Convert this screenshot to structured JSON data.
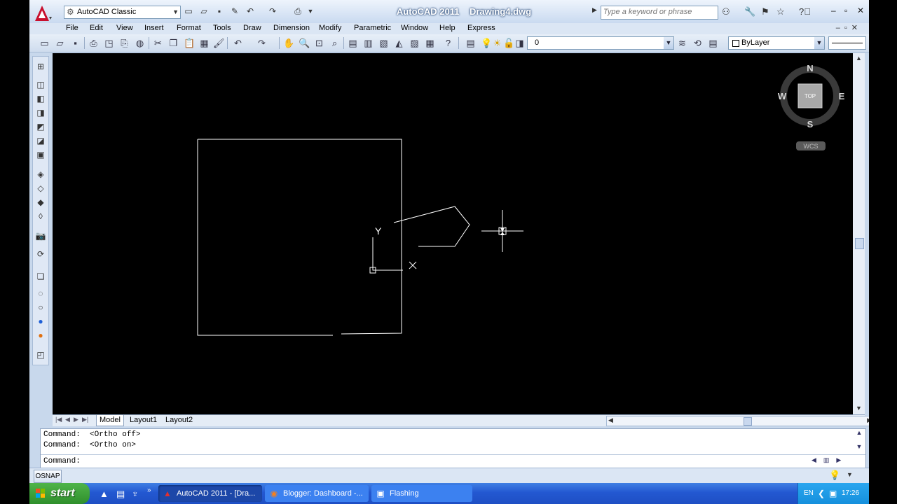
{
  "window": {
    "title": "AutoCAD 2011    Drawing4.dwg",
    "workspace": "AutoCAD Classic"
  },
  "search": {
    "placeholder": "Type a keyword or phrase"
  },
  "menu": [
    "File",
    "Edit",
    "View",
    "Insert",
    "Format",
    "Tools",
    "Draw",
    "Dimension",
    "Modify",
    "Parametric",
    "Window",
    "Help",
    "Express"
  ],
  "layer": {
    "current": "0"
  },
  "color": {
    "current": "ByLayer"
  },
  "viewcube": {
    "n": "N",
    "s": "S",
    "e": "E",
    "w": "W",
    "face": "TOP",
    "wcs": "WCS"
  },
  "ucs": {
    "x": "X",
    "y": "Y"
  },
  "tabs": {
    "model": "Model",
    "layout1": "Layout1",
    "layout2": "Layout2"
  },
  "command": {
    "history": [
      "Command:  <Ortho off>",
      "Command:  <Ortho on>"
    ],
    "prompt": "Command:"
  },
  "status": {
    "osnap": "OSNAP"
  },
  "taskbar": {
    "start": "start",
    "tasks": [
      "AutoCAD 2011 - [Dra...",
      "Blogger: Dashboard -...",
      "Flashing"
    ],
    "lang": "EN",
    "time": "17:26"
  },
  "colors": {
    "title_text": "#ffffff",
    "canvas": "#000000",
    "taskbar": "#2358d1"
  }
}
